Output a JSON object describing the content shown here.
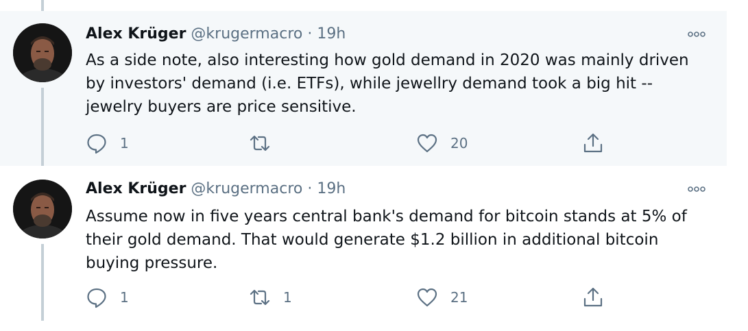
{
  "tweets": [
    {
      "author_name": "Alex Krüger",
      "handle": "@krugermacro",
      "separator": "·",
      "time": "19h",
      "text": "As a side note, also interesting how gold demand in 2020 was mainly driven by investors' demand (i.e. ETFs), while jewellry demand took a big hit -- jewelry buyers are price sensitive.",
      "replies": "1",
      "retweets": "",
      "likes": "20"
    },
    {
      "author_name": "Alex Krüger",
      "handle": "@krugermacro",
      "separator": "·",
      "time": "19h",
      "text": "Assume now in five years central bank's demand for bitcoin stands at 5% of their gold demand. That would generate $1.2 billion in additional bitcoin buying pressure.",
      "replies": "1",
      "retweets": "1",
      "likes": "21"
    }
  ],
  "icons": {
    "reply": "reply-icon",
    "retweet": "retweet-icon",
    "like": "heart-icon",
    "share": "share-icon",
    "more": "more-options-icon"
  },
  "colors": {
    "highlight_bg": "#f5f8fa",
    "secondary_text": "#5b7083",
    "thread_line": "#c4cfd6"
  }
}
